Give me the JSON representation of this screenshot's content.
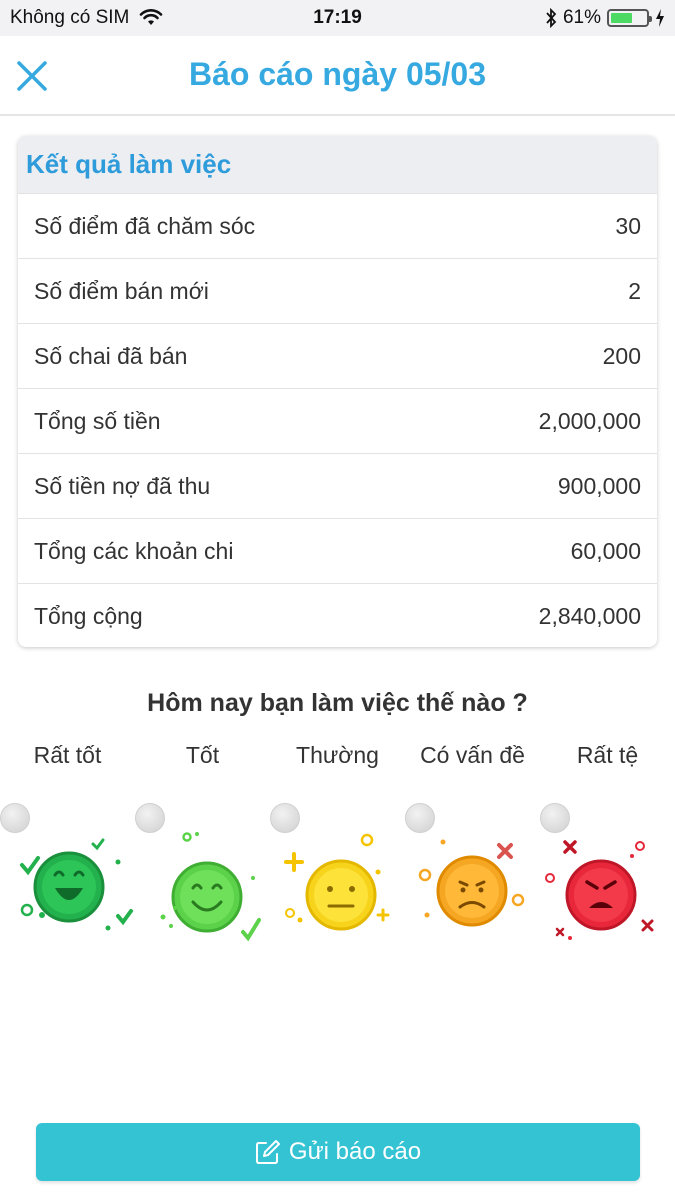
{
  "status_bar": {
    "carrier": "Không có SIM",
    "time": "17:19",
    "battery": "61%",
    "battery_level": 0.61
  },
  "header": {
    "title": "Báo cáo ngày 05/03",
    "close_icon": "close-icon"
  },
  "results": {
    "title": "Kết quả làm việc",
    "rows": [
      {
        "label": "Số điểm đã chăm sóc",
        "value": "30"
      },
      {
        "label": "Số điểm bán mới",
        "value": "2"
      },
      {
        "label": "Số chai đã bán",
        "value": "200"
      },
      {
        "label": "Tổng số tiền",
        "value": "2,000,000"
      },
      {
        "label": "Số tiền nợ đã thu",
        "value": "900,000"
      },
      {
        "label": "Tổng các khoản chi",
        "value": "60,000"
      },
      {
        "label": "Tổng cộng",
        "value": "2,840,000"
      }
    ]
  },
  "mood": {
    "question": "Hôm nay bạn làm việc thế nào ?",
    "options": [
      {
        "label": "Rất tốt",
        "icon": "very-happy-face-icon",
        "color": "#22b14c"
      },
      {
        "label": "Tốt",
        "icon": "happy-face-icon",
        "color": "#5cd24a"
      },
      {
        "label": "Thường",
        "icon": "neutral-face-icon",
        "color": "#f7d31c"
      },
      {
        "label": "Có vấn đề",
        "icon": "worried-face-icon",
        "color": "#f5a623"
      },
      {
        "label": "Rất tệ",
        "icon": "angry-face-icon",
        "color": "#e8283a"
      }
    ]
  },
  "submit": {
    "label": "Gửi báo cáo",
    "icon": "edit-icon"
  },
  "colors": {
    "title_blue": "#35a9e0",
    "button_teal": "#34c3d3"
  }
}
